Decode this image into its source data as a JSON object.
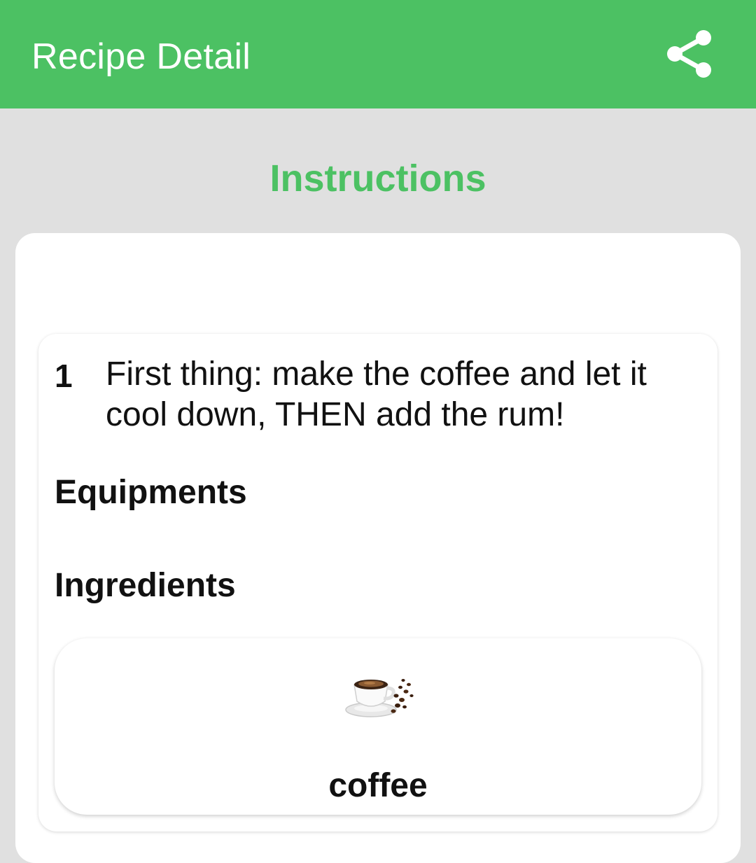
{
  "app_bar": {
    "title": "Recipe Detail",
    "share_icon": "share-icon",
    "background": "#4cc163"
  },
  "section": {
    "heading": "Instructions",
    "accent": "#4cc163"
  },
  "steps": [
    {
      "number": "1",
      "text": "First thing: make the coffee and let it cool down, THEN add the rum!",
      "equipments_label": "Equipments",
      "ingredients_label": "Ingredients",
      "ingredients": [
        {
          "name": "coffee",
          "image_icon": "coffee-cup-icon"
        }
      ]
    }
  ]
}
